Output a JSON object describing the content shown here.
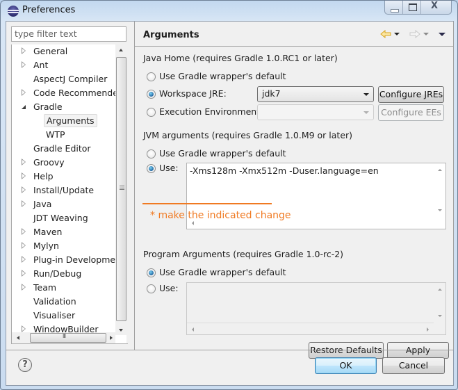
{
  "window": {
    "title": "Preferences",
    "controls": {
      "minimize": "minimize",
      "maximize": "maximize",
      "close": "close"
    }
  },
  "sidebar": {
    "filter_placeholder": "type filter text",
    "items": [
      {
        "label": "General",
        "expandable": true,
        "level": 0
      },
      {
        "label": "Ant",
        "expandable": true,
        "level": 0
      },
      {
        "label": "AspectJ Compiler",
        "expandable": false,
        "level": 0
      },
      {
        "label": "Code Recommenders",
        "expandable": true,
        "level": 0
      },
      {
        "label": "Gradle",
        "expandable": true,
        "expanded": true,
        "level": 0
      },
      {
        "label": "Arguments",
        "expandable": false,
        "level": 1,
        "selected": true
      },
      {
        "label": "WTP",
        "expandable": false,
        "level": 1
      },
      {
        "label": "Gradle Editor",
        "expandable": false,
        "level": 0
      },
      {
        "label": "Groovy",
        "expandable": true,
        "level": 0
      },
      {
        "label": "Help",
        "expandable": true,
        "level": 0
      },
      {
        "label": "Install/Update",
        "expandable": true,
        "level": 0
      },
      {
        "label": "Java",
        "expandable": true,
        "level": 0
      },
      {
        "label": "JDT Weaving",
        "expandable": false,
        "level": 0
      },
      {
        "label": "Maven",
        "expandable": true,
        "level": 0
      },
      {
        "label": "Mylyn",
        "expandable": true,
        "level": 0
      },
      {
        "label": "Plug-in Development",
        "expandable": true,
        "level": 0
      },
      {
        "label": "Run/Debug",
        "expandable": true,
        "level": 0
      },
      {
        "label": "Team",
        "expandable": true,
        "level": 0
      },
      {
        "label": "Validation",
        "expandable": false,
        "level": 0
      },
      {
        "label": "Visualiser",
        "expandable": false,
        "level": 0
      },
      {
        "label": "WindowBuilder",
        "expandable": true,
        "level": 0
      }
    ]
  },
  "page": {
    "title": "Arguments",
    "nav": {
      "back": "back",
      "forward": "forward",
      "menu": "view menu"
    },
    "java_home": {
      "heading": "Java Home (requires Gradle 1.0.RC1 or later)",
      "options": [
        {
          "label": "Use Gradle wrapper's default",
          "checked": false
        },
        {
          "label": "Workspace JRE:",
          "checked": true
        },
        {
          "label": "Execution Environment",
          "checked": false
        }
      ],
      "workspace_jre_value": "jdk7",
      "execution_env_value": "",
      "configure_jres": "Configure JREs",
      "configure_ees": "Configure EEs"
    },
    "jvm_args": {
      "heading": "JVM arguments (requires Gradle 1.0.M9 or later)",
      "options": [
        {
          "label": "Use Gradle wrapper's default",
          "checked": false
        },
        {
          "label": "Use:",
          "checked": true
        }
      ],
      "value": "-Xms128m -Xmx512m -Duser.language=en"
    },
    "annotation": {
      "text": "* make the indicated change",
      "color": "#f07a22"
    },
    "program_args": {
      "heading": "Program Arguments (requires Gradle 1.0-rc-2)",
      "options": [
        {
          "label": "Use Gradle wrapper's default",
          "checked": true
        },
        {
          "label": "Use:",
          "checked": false
        }
      ],
      "value": ""
    },
    "restore_defaults": "Restore Defaults",
    "apply": "Apply"
  },
  "footer": {
    "help": "?",
    "ok": "OK",
    "cancel": "Cancel"
  }
}
